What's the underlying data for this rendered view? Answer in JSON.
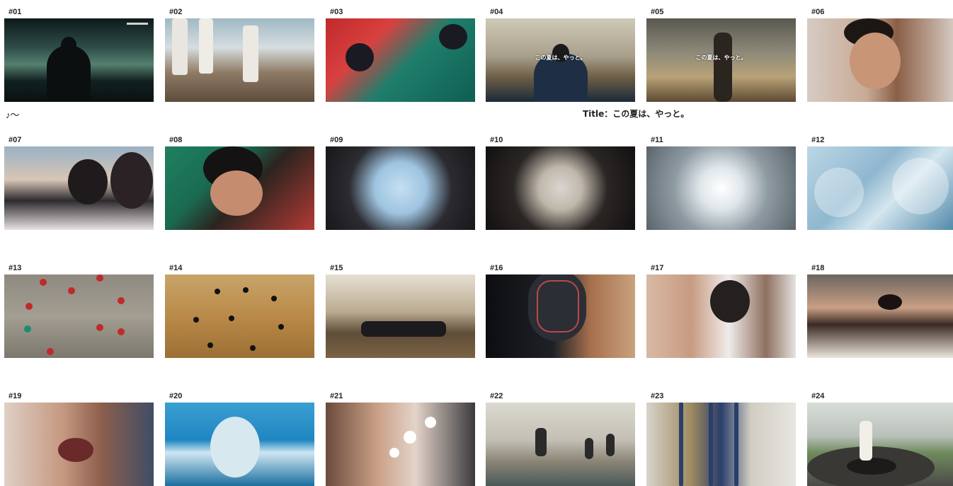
{
  "captions": {
    "note": "♪～",
    "title": "Title：この夏は、やっと。"
  },
  "frames": [
    {
      "num": "#01",
      "overlay": ""
    },
    {
      "num": "#02",
      "overlay": ""
    },
    {
      "num": "#03",
      "overlay": ""
    },
    {
      "num": "#04",
      "overlay": "この夏は、やっと。"
    },
    {
      "num": "#05",
      "overlay": "この夏は、やっと。"
    },
    {
      "num": "#06",
      "overlay": ""
    },
    {
      "num": "#07",
      "overlay": ""
    },
    {
      "num": "#08",
      "overlay": ""
    },
    {
      "num": "#09",
      "overlay": ""
    },
    {
      "num": "#10",
      "overlay": ""
    },
    {
      "num": "#11",
      "overlay": ""
    },
    {
      "num": "#12",
      "overlay": ""
    },
    {
      "num": "#13",
      "overlay": ""
    },
    {
      "num": "#14",
      "overlay": ""
    },
    {
      "num": "#15",
      "overlay": ""
    },
    {
      "num": "#16",
      "overlay": ""
    },
    {
      "num": "#17",
      "overlay": ""
    },
    {
      "num": "#18",
      "overlay": ""
    },
    {
      "num": "#19",
      "overlay": ""
    },
    {
      "num": "#20",
      "overlay": ""
    },
    {
      "num": "#21",
      "overlay": ""
    },
    {
      "num": "#22",
      "overlay": ""
    },
    {
      "num": "#23",
      "overlay": ""
    },
    {
      "num": "#24",
      "overlay": ""
    }
  ]
}
